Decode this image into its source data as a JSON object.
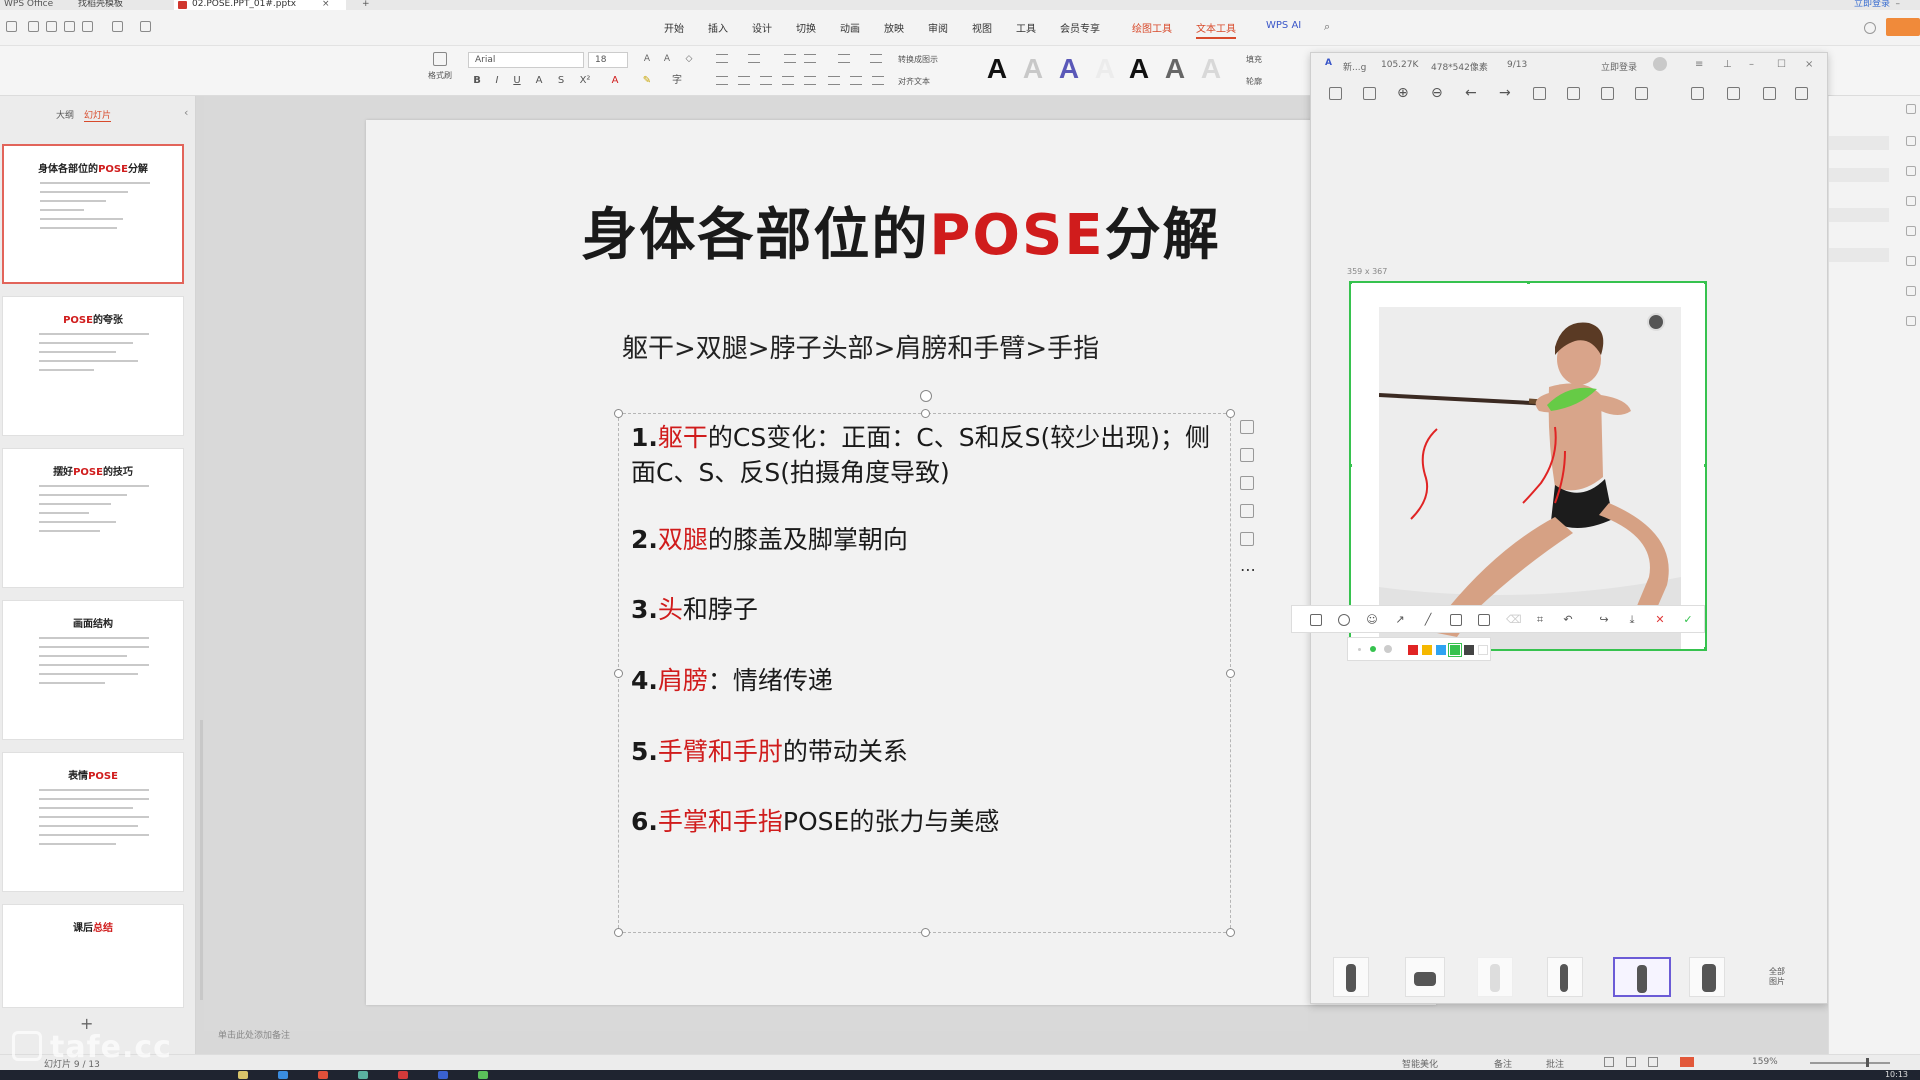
{
  "window": {
    "app_title": "WPS Office",
    "tab_home": "找稻壳模板",
    "file_tab": "02.POSE.PPT_01#.pptx",
    "right_text": "立即登录"
  },
  "ribbon": {
    "menu": [
      "开始",
      "插入",
      "设计",
      "切换",
      "动画",
      "放映",
      "审阅",
      "视图",
      "工具",
      "会员专享",
      "绘图工具",
      "文本工具",
      "WPS AI"
    ],
    "format_painter": "格式刷",
    "font_name": "Arial",
    "font_size": "18",
    "text_direction": "转换成图示",
    "align_text": "对齐文本",
    "fill": "填充",
    "outline": "轮廓"
  },
  "left_panel": {
    "tab_outline": "大纲",
    "tab_slides": "幻灯片",
    "thumbnails": [
      {
        "title_a": "身体各部位的",
        "title_hl": "POSE",
        "title_b": "分解"
      },
      {
        "title_a": "",
        "title_hl": "POSE",
        "title_b": "的夸张"
      },
      {
        "title_a": "摆好",
        "title_hl": "POSE",
        "title_b": "的技巧"
      },
      {
        "title_a": "画面结构",
        "title_hl": "",
        "title_b": ""
      },
      {
        "title_a": "表情",
        "title_hl": "POSE",
        "title_b": ""
      },
      {
        "title_a": "课后",
        "title_hl": "总结",
        "title_b": ""
      }
    ]
  },
  "slide": {
    "title_a": "身体各部位的",
    "title_hl": "POSE",
    "title_b": "分解",
    "subtitle": "躯干>双腿>脖子头部>肩膀和手臂>手指",
    "points": [
      {
        "num": "1.",
        "red": "躯干",
        "rest": "的CS变化：正面：C、S和反S(较少出现)；侧面C、S、反S(拍摄角度导致)"
      },
      {
        "num": "2.",
        "red": "双腿",
        "rest": "的膝盖及脚掌朝向"
      },
      {
        "num": "3.",
        "red": "头",
        "rest": "和脖子"
      },
      {
        "num": "4.",
        "red": "肩膀",
        "rest": "：情绪传递"
      },
      {
        "num": "5.",
        "red": "手臂和手肘",
        "rest": "的带动关系"
      },
      {
        "num": "6.",
        "red": "手掌和手指",
        "rest": "POSE的张力与美感"
      }
    ],
    "notes_hint": "单击此处添加备注"
  },
  "viewer": {
    "name": "新...g",
    "file_size": "105.27K",
    "dimensions": "478*542像素",
    "index": "9/13",
    "login": "立即登录",
    "crop_size": "359 x 367",
    "film_all": "全部 图片",
    "colors": [
      "#e02424",
      "#f5b800",
      "#2ea3f2",
      "#36c24e",
      "#444444",
      "#ffffff"
    ]
  },
  "statusbar": {
    "slide_info": "幻灯片 9 / 13",
    "smart_beautify": "智能美化",
    "notes": "备注",
    "comments": "批注",
    "zoom": "159%",
    "clock": "10:13"
  },
  "watermark": "tafe.cc"
}
